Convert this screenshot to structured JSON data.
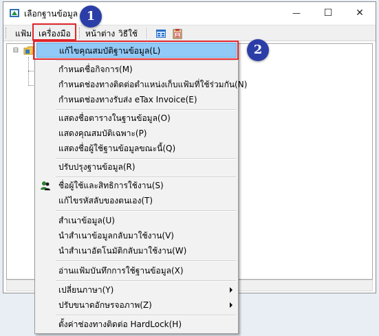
{
  "window": {
    "title": "เลือกฐานข้อมูล",
    "minimize_symbol": "—",
    "maximize_symbol": "☐",
    "close_symbol": "✕"
  },
  "menubar": {
    "items": [
      "แฟ้ม",
      "เครื่องมือ",
      "หน้าต่าง",
      "วิธีใช้"
    ]
  },
  "step_badges": [
    "1",
    "2"
  ],
  "tools_menu": {
    "items": [
      {
        "label": "แก้ไขคุณสมบัติฐานข้อมูล(L)"
      },
      {
        "label": "กำหนดชื่อกิจการ(M)"
      },
      {
        "label": "กำหนดช่องทางติดต่อตำแหน่งเก็บแฟ้มที่ใช้ร่วมกัน(N)"
      },
      {
        "label": "กำหนดช่องทางรับส่ง eTax Invoice(E)"
      },
      {
        "label": "แสดงชื่อตารางในฐานข้อมูล(O)"
      },
      {
        "label": "แสดงคุณสมบัติเฉพาะ(P)"
      },
      {
        "label": "แสดงชื่อผู้ใช้ฐานข้อมูลขณะนี้(Q)"
      },
      {
        "label": "ปรับปรุงฐานข้อมูล(R)"
      },
      {
        "label": "ชื่อผู้ใช้และสิทธิการใช้งาน(S)"
      },
      {
        "label": "แก้ไขรหัสลับของตนเอง(T)"
      },
      {
        "label": "สำเนาข้อมูล(U)"
      },
      {
        "label": "นำสำเนาข้อมูลกลับมาใช้งาน(V)"
      },
      {
        "label": "นำสำเนาอัตโนมัติกลับมาใช้งาน(W)"
      },
      {
        "label": "อ่านแฟ้มบันทึกการใช้ฐานข้อมูล(X)"
      },
      {
        "label": "เปลี่ยนภาษา(Y)"
      },
      {
        "label": "ปรับขนาดอักษรจอภาพ(Z)"
      },
      {
        "label": "ตั้งค่าช่องทางติดต่อ HardLock(H)"
      }
    ]
  },
  "colors": {
    "highlight_red": "#e0262c",
    "badge_blue": "#2b3ea8",
    "selected_bg": "#91c9f7"
  }
}
